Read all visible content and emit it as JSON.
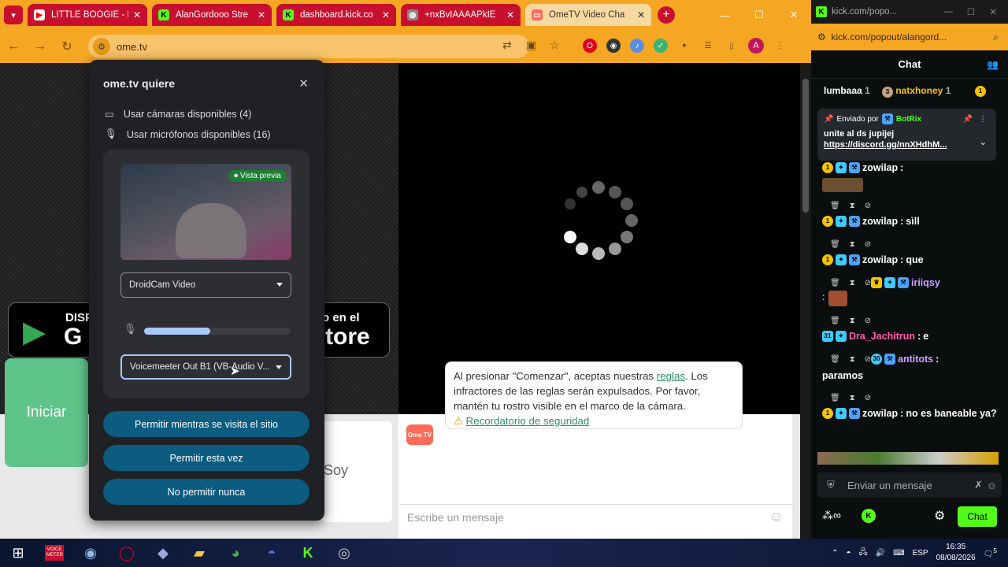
{
  "browser": {
    "tabs": [
      {
        "title": "LITTLE BOOGIE - E",
        "favicon": "youtube-icon",
        "color": "#ff0000"
      },
      {
        "title": "AlanGordooo Stre",
        "favicon": "kick-icon",
        "color": "#53fc18"
      },
      {
        "title": "dashboard.kick.co",
        "favicon": "kick-icon",
        "color": "#53fc18"
      },
      {
        "title": "+nxBvIAAAAPkIE",
        "favicon": "globe-icon",
        "color": "#888888"
      },
      {
        "title": "OmeTV Video Cha",
        "favicon": "ometv-icon",
        "color": "#ff6b5a"
      }
    ],
    "url": "ome.tv",
    "profile_initial": "A"
  },
  "permission_dialog": {
    "title": "ome.tv quiere",
    "camera_text": "Usar cámaras disponibles (4)",
    "mic_text": "Usar micrófonos disponibles (16)",
    "preview_badge": "Vista previa",
    "camera_select": "DroidCam Video",
    "mic_select": "Voicemeeter Out B1 (VB-Audio V...",
    "mic_level": 0.45,
    "buttons": [
      "Permitir mientras se visita el sitio",
      "Permitir esta vez",
      "No permitir nunca"
    ]
  },
  "page": {
    "start_button": "Iniciar",
    "store_left": "DISP",
    "store_left_big": "G",
    "store_right": "o en el",
    "store_right_big": "tore",
    "soy_text": "Soy",
    "logo_text": "Ome TV",
    "rules_text": "Al presionar \"Comenzar\", aceptas nuestras ",
    "rules_link": "reglas",
    "rules_text2": ". Los infractores de las reglas serán expulsados. Por favor, mantén tu rostro visible en el marco de la cámara.",
    "safety_link": "Recordatorio de seguridad",
    "message_placeholder": "Escribe un mensaje"
  },
  "chat": {
    "window_url": "kick.com/popo...",
    "url": "kick.com/popout/alangord...",
    "title": "Chat",
    "top_users": [
      {
        "name": "lumbaaa",
        "rank": "1"
      },
      {
        "name": "natxhoney",
        "rank": "1"
      }
    ],
    "pinned_by": "Enviado por",
    "pinned_user": "BotRix",
    "pinned_message": "unite al ds jupijej",
    "pinned_link": "https://discord.gg/nnXHdhM...",
    "messages": [
      {
        "user": "zowilap",
        "text": "",
        "color": "#ffffff"
      },
      {
        "user": "zowilap",
        "text": "sìll",
        "color": "#ffffff"
      },
      {
        "user": "zowilap",
        "text": "que",
        "color": "#ffffff"
      },
      {
        "user": "iriiqsy",
        "text": "",
        "color": "#c9a0ff"
      },
      {
        "user": "Dra_Jachitrun",
        "text": "e",
        "color": "#ff5ca8"
      },
      {
        "user": "antitots",
        "text": "paramos",
        "color": "#c9a0ff"
      },
      {
        "user": "zowilap",
        "text": "no es baneable ya?",
        "color": "#ffffff"
      }
    ],
    "input_placeholder": "Enviar un mensaje",
    "send_button": "Chat"
  },
  "taskbar": {
    "time": "16:35",
    "date": "08/08/2026",
    "language": "ESP",
    "notifications": "5",
    "voicemeeter_label": "VOICE METER"
  }
}
